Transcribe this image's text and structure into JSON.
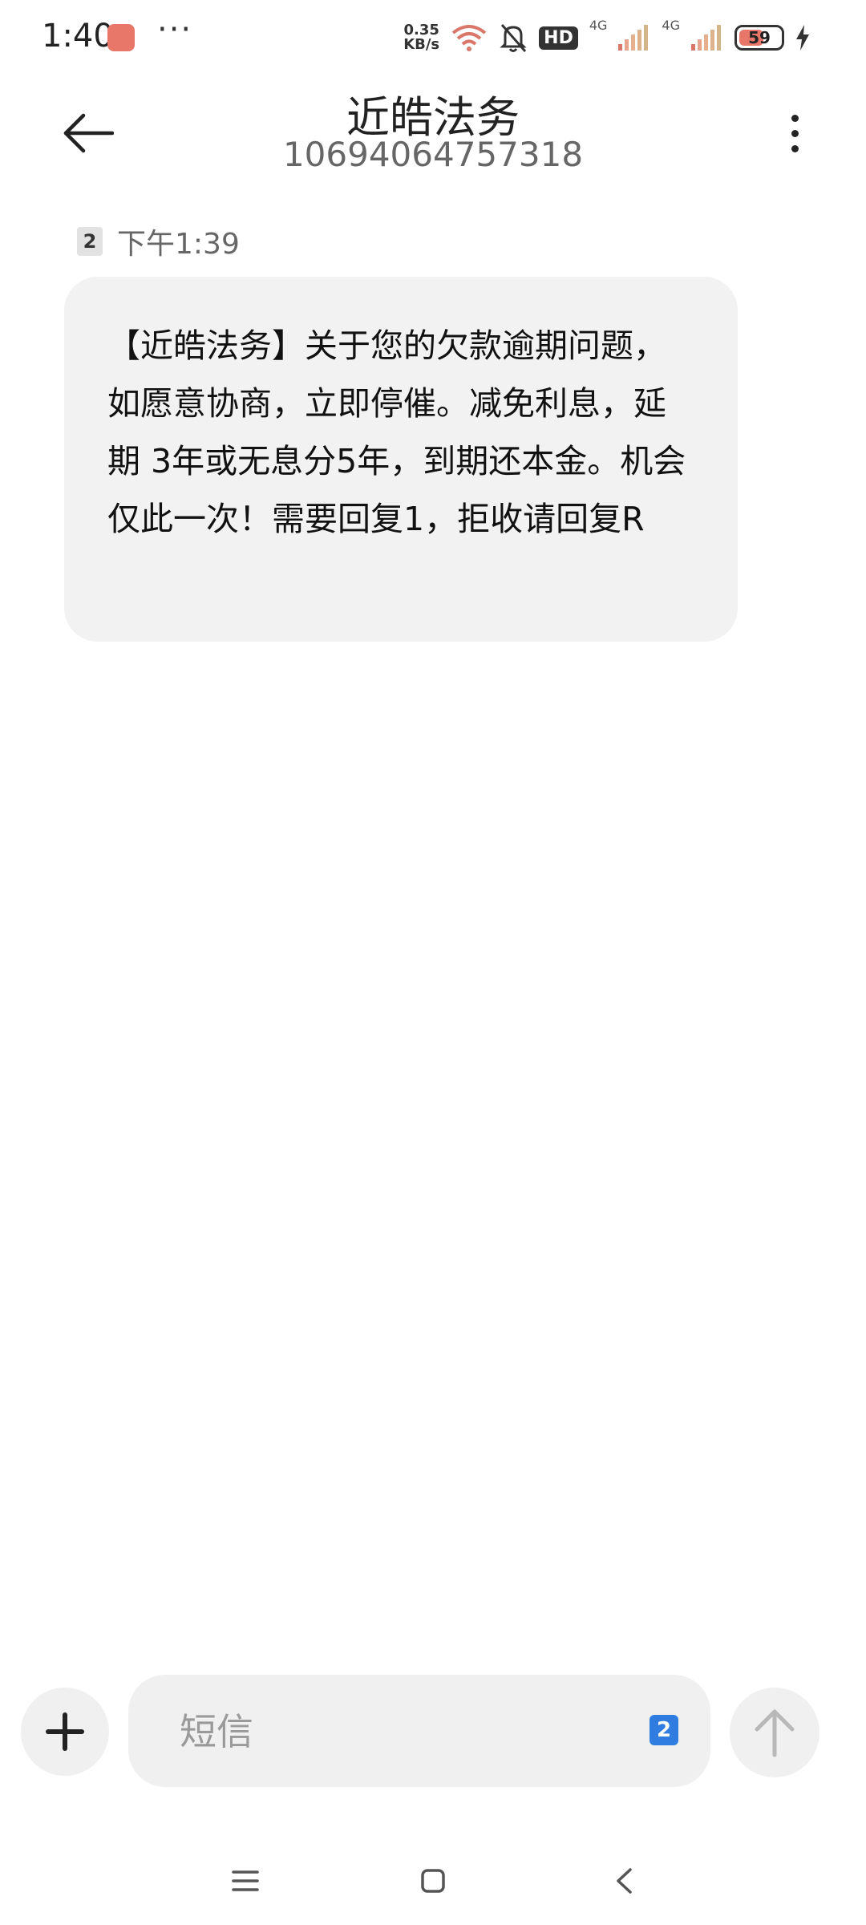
{
  "status_bar": {
    "time": "1:40",
    "more": "···",
    "net_speed_value": "0.35",
    "net_speed_unit": "KB/s",
    "hd_label": "HD",
    "signal1_label": "4G",
    "signal2_label": "4G",
    "battery_level": "59",
    "battery_fraction": 0.59
  },
  "header": {
    "contact_name": "近皓法务",
    "contact_number": "10694064757318"
  },
  "message": {
    "sim": "2",
    "time": "下午1:39",
    "text": "【近皓法务】关于您的欠款逾期问题，如愿意协商，立即停催。减免利息，延期 3年或无息分5年，到期还本金。机会仅此一次！需要回复1，拒收请回复R"
  },
  "compose": {
    "placeholder": "短信",
    "sim": "2"
  },
  "colors": {
    "bubble": "#f2f2f2",
    "sim_accent": "#2f7de0",
    "battery_fill": "#e8776a"
  }
}
